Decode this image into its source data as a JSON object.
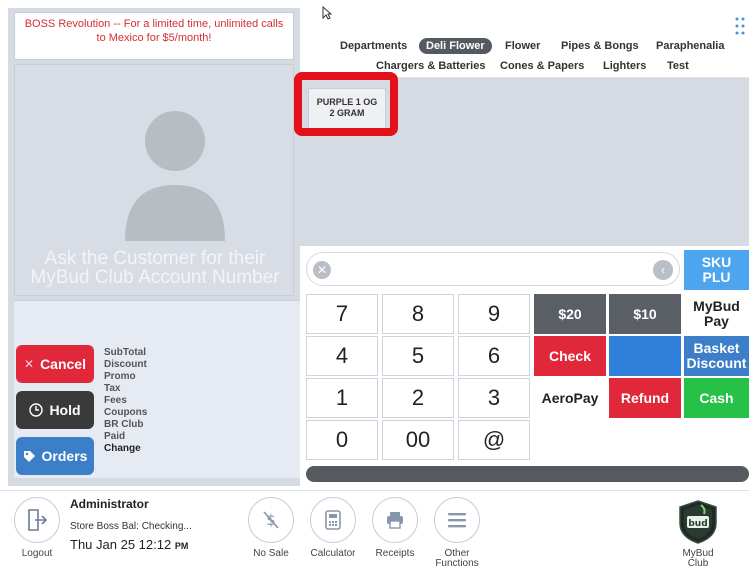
{
  "promo": {
    "text": "BOSS Revolution -- For a limited time, unlimited calls to Mexico for $5/month!"
  },
  "customer": {
    "prompt": "Ask the Customer for their MyBud Club Account Number"
  },
  "actions": {
    "cancel": "Cancel",
    "hold": "Hold",
    "orders": "Orders"
  },
  "totals": {
    "labels": [
      "SubTotal",
      "Discount",
      "Promo",
      "Tax",
      "Fees",
      "Coupons",
      "BR Club",
      "Paid",
      "Change"
    ]
  },
  "tabs": {
    "row1": [
      "Departments",
      "Deli Flower",
      "Flower",
      "Pipes & Bongs",
      "Paraphenalia"
    ],
    "row2": [
      "Chargers & Batteries",
      "Cones & Papers",
      "Lighters",
      "Test"
    ],
    "active": "Deli Flower"
  },
  "product": {
    "line1": "PURPLE 1 OG",
    "line2": "2 GRAM"
  },
  "sku": {
    "label_line1": "SKU",
    "label_line2": "PLU"
  },
  "keypad": {
    "keys": [
      "7",
      "8",
      "9",
      "4",
      "5",
      "6",
      "1",
      "2",
      "3",
      "0",
      "00",
      "@"
    ]
  },
  "payment": {
    "b20": "$20",
    "b10": "$10",
    "mybud_pay": "MyBud Pay",
    "check": "Check",
    "basket_discount": "Basket Discount",
    "aeropay": "AeroPay",
    "refund": "Refund",
    "cash": "Cash"
  },
  "bottom": {
    "logout": "Logout",
    "user": "Administrator",
    "store": "Store Boss Bal: Checking...",
    "date": "Thu Jan 25 12:12",
    "ampm": "PM",
    "no_sale": "No Sale",
    "calculator": "Calculator",
    "receipts": "Receipts",
    "other_functions": "Other Functions",
    "mybud_club": "MyBud Club"
  },
  "colors": {
    "red": "#e0283a",
    "green": "#27c148",
    "blue": "#3d7ec8",
    "dark": "#3a3a3a",
    "gray_button": "#5a5f66",
    "sku_blue": "#4ca5ee"
  }
}
